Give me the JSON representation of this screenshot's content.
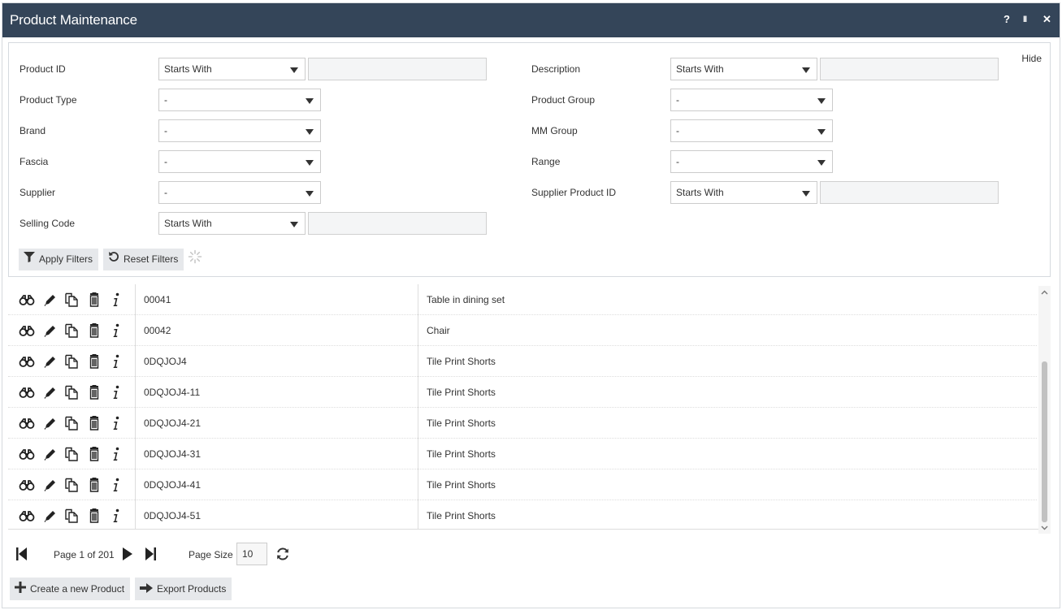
{
  "window": {
    "title": "Product Maintenance",
    "help_label": "?",
    "pause_label": "II",
    "close_label": "✕"
  },
  "filters": {
    "hide_label": "Hide",
    "product_id": {
      "label": "Product ID",
      "operator": "Starts With",
      "value": ""
    },
    "product_type": {
      "label": "Product Type",
      "value": "-"
    },
    "brand": {
      "label": "Brand",
      "value": "-"
    },
    "fascia": {
      "label": "Fascia",
      "value": "-"
    },
    "supplier": {
      "label": "Supplier",
      "value": "-"
    },
    "selling_code": {
      "label": "Selling Code",
      "operator": "Starts With",
      "value": ""
    },
    "description": {
      "label": "Description",
      "operator": "Starts With",
      "value": ""
    },
    "product_group": {
      "label": "Product Group",
      "value": "-"
    },
    "mm_group": {
      "label": "MM Group",
      "value": "-"
    },
    "range": {
      "label": "Range",
      "value": "-"
    },
    "supplier_product_id": {
      "label": "Supplier Product ID",
      "operator": "Starts With",
      "value": ""
    },
    "apply_label": "Apply Filters",
    "reset_label": "Reset Filters"
  },
  "grid": {
    "rows": [
      {
        "id": "00041",
        "description": "Table in dining set"
      },
      {
        "id": "00042",
        "description": "Chair"
      },
      {
        "id": "0DQJOJ4",
        "description": "Tile Print Shorts"
      },
      {
        "id": "0DQJOJ4-11",
        "description": "Tile Print Shorts"
      },
      {
        "id": "0DQJOJ4-21",
        "description": "Tile Print Shorts"
      },
      {
        "id": "0DQJOJ4-31",
        "description": "Tile Print Shorts"
      },
      {
        "id": "0DQJOJ4-41",
        "description": "Tile Print Shorts"
      },
      {
        "id": "0DQJOJ4-51",
        "description": "Tile Print Shorts"
      }
    ],
    "action_icons": [
      "binoculars-icon",
      "pencil-icon",
      "copy-icon",
      "trash-icon",
      "info-icon"
    ]
  },
  "pager": {
    "page_text": "Page 1 of 201",
    "page_size_label": "Page Size",
    "page_size": "10"
  },
  "footer": {
    "create_label": "Create a new Product",
    "export_label": "Export Products"
  },
  "colors": {
    "titlebar": "#344559",
    "button_bg": "#e6e8eb"
  }
}
